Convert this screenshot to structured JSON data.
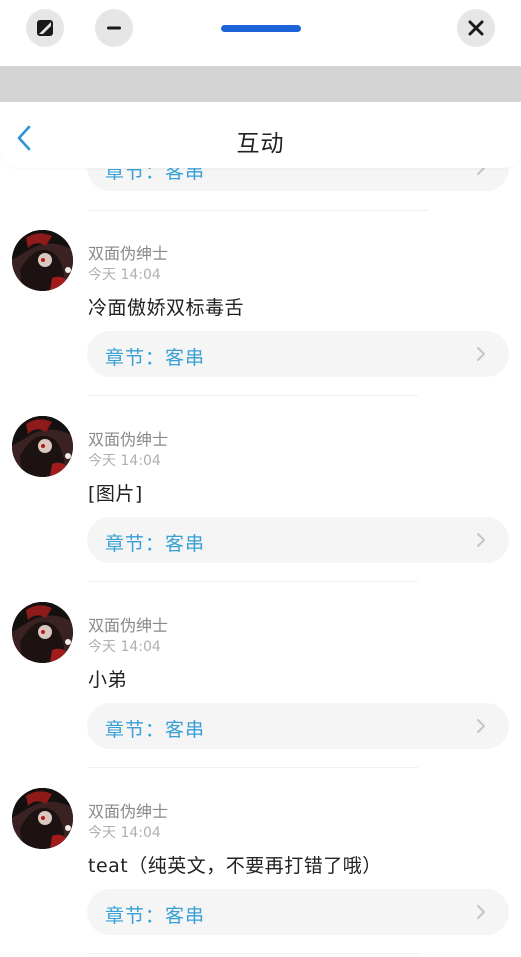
{
  "header": {
    "title": "互动",
    "back_icon": "chevron-left-icon"
  },
  "window_controls": {
    "left_button_1_icon": "aspect-ratio-icon",
    "left_button_2_icon": "minimize-icon",
    "right_button_icon": "close-icon",
    "handle_color": "#1e63d8"
  },
  "colors": {
    "accent": "#38a0d6",
    "chapter_bg": "#f5f5f5"
  },
  "partial_item": {
    "chapter_label": "章节：客串"
  },
  "items": [
    {
      "username": "双面伪绅士",
      "time": "今天 14:04",
      "message": "冷面傲娇双标毒舌",
      "chapter_label": "章节：客串"
    },
    {
      "username": "双面伪绅士",
      "time": "今天 14:04",
      "message": "[图片]",
      "chapter_label": "章节：客串"
    },
    {
      "username": "双面伪绅士",
      "time": "今天 14:04",
      "message": "小弟",
      "chapter_label": "章节：客串"
    },
    {
      "username": "双面伪绅士",
      "time": "今天 14:04",
      "message": "teat（纯英文，不要再打错了哦）",
      "chapter_label": "章节：客串"
    }
  ]
}
